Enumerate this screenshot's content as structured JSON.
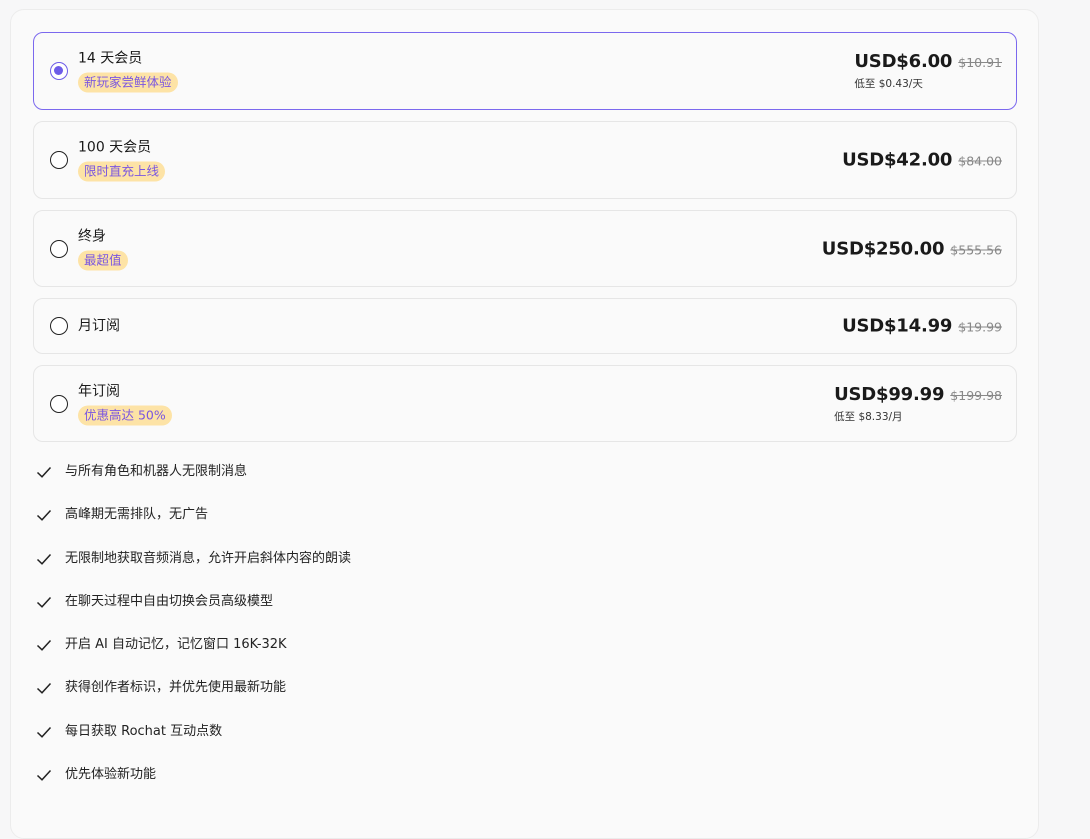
{
  "plans": [
    {
      "name": "14 天会员",
      "badge": "新玩家尝鲜体验",
      "price": "USD$6.00",
      "original": "$10.91",
      "per": "低至 $0.43/天",
      "selected": true
    },
    {
      "name": "100 天会员",
      "badge": "限时直充上线",
      "price": "USD$42.00",
      "original": "$84.00",
      "per": "",
      "selected": false
    },
    {
      "name": "终身",
      "badge": "最超值",
      "price": "USD$250.00",
      "original": "$555.56",
      "per": "",
      "selected": false
    },
    {
      "name": "月订阅",
      "badge": "",
      "price": "USD$14.99",
      "original": "$19.99",
      "per": "",
      "selected": false
    },
    {
      "name": "年订阅",
      "badge": "优惠高达 50%",
      "price": "USD$99.99",
      "original": "$199.98",
      "per": "低至 $8.33/月",
      "selected": false
    }
  ],
  "features": [
    "与所有角色和机器人无限制消息",
    "高峰期无需排队，无广告",
    "无限制地获取音频消息，允许开启斜体内容的朗读",
    "在聊天过程中自由切换会员高级模型",
    "开启 AI 自动记忆，记忆窗口 16K-32K",
    "获得创作者标识，并优先使用最新功能",
    "每日获取 Rochat 互动点数",
    "优先体验新功能"
  ],
  "icons": {
    "radio": "radio-icon",
    "check": "check-icon"
  },
  "colors": {
    "accent": "#6d5ce8",
    "badge_bg": "#fde3a6",
    "badge_text": "#7a56e0"
  }
}
